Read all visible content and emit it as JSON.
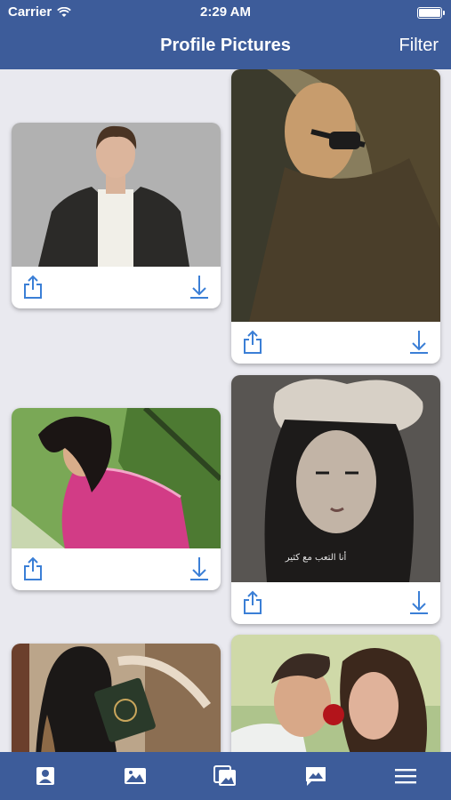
{
  "status": {
    "carrier": "Carrier",
    "time": "2:29 AM"
  },
  "nav": {
    "title": "Profile Pictures",
    "filter_label": "Filter"
  },
  "colors": {
    "nav_bg": "#3d5c9a",
    "icon_blue": "#3b7fd6",
    "background": "#e9e9ef"
  },
  "cards": [
    {
      "subject": "man in leather jacket",
      "image_text": ""
    },
    {
      "subject": "woman with sunglasses",
      "image_text": ""
    },
    {
      "subject": "girl in pink plaid shirt",
      "image_text": ""
    },
    {
      "subject": "woman with flower headpiece",
      "image_text": "أنا التعب مع كثير"
    },
    {
      "subject": "woman in hijab with book",
      "image_text": ""
    },
    {
      "subject": "couple with rose",
      "image_text": ""
    }
  ],
  "tabs": [
    "profile-icon",
    "image-icon",
    "gallery-icon",
    "message-image-icon",
    "menu-icon"
  ]
}
